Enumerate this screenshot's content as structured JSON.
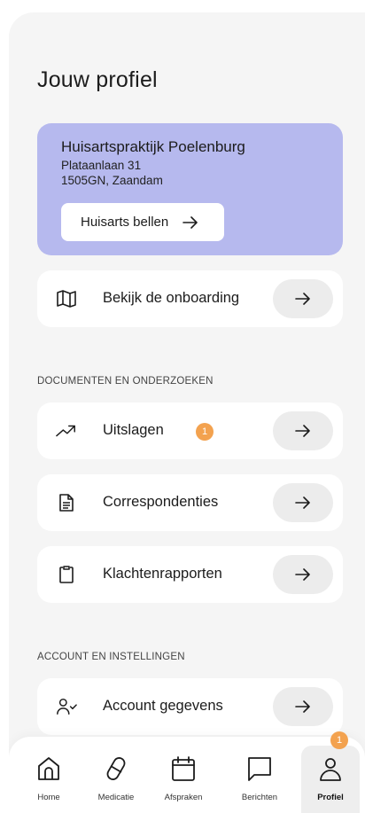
{
  "page": {
    "title": "Jouw profiel"
  },
  "practice": {
    "name": "Huisartspraktijk Poelenburg",
    "address_line1": "Plataanlaan 31",
    "address_line2": "1505GN, Zaandam",
    "call_label": "Huisarts bellen",
    "background": "#b6b9ee"
  },
  "onboarding": {
    "label": "Bekijk de onboarding",
    "icon": "map-icon"
  },
  "documents": {
    "section_title": "DOCUMENTEN EN ONDERZOEKEN",
    "items": [
      {
        "label": "Uitslagen",
        "icon": "trending-up-icon",
        "badge": "1"
      },
      {
        "label": "Correspondenties",
        "icon": "document-icon"
      },
      {
        "label": "Klachtenrapporten",
        "icon": "clipboard-icon"
      }
    ]
  },
  "account": {
    "section_title": "ACCOUNT EN INSTELLINGEN",
    "items": [
      {
        "label": "Account gegevens",
        "icon": "user-check-icon"
      }
    ]
  },
  "tabbar": {
    "items": [
      {
        "label": "Home",
        "icon": "home-icon"
      },
      {
        "label": "Medicatie",
        "icon": "pill-icon"
      },
      {
        "label": "Afspraken",
        "icon": "calendar-icon"
      },
      {
        "label": "Berichten",
        "icon": "message-icon"
      },
      {
        "label": "Profiel",
        "icon": "user-icon",
        "active": true,
        "badge": "1"
      }
    ]
  },
  "colors": {
    "badge": "#f3a24f",
    "arrow_pill": "#ececec",
    "active_tab": "#eeeeee"
  }
}
